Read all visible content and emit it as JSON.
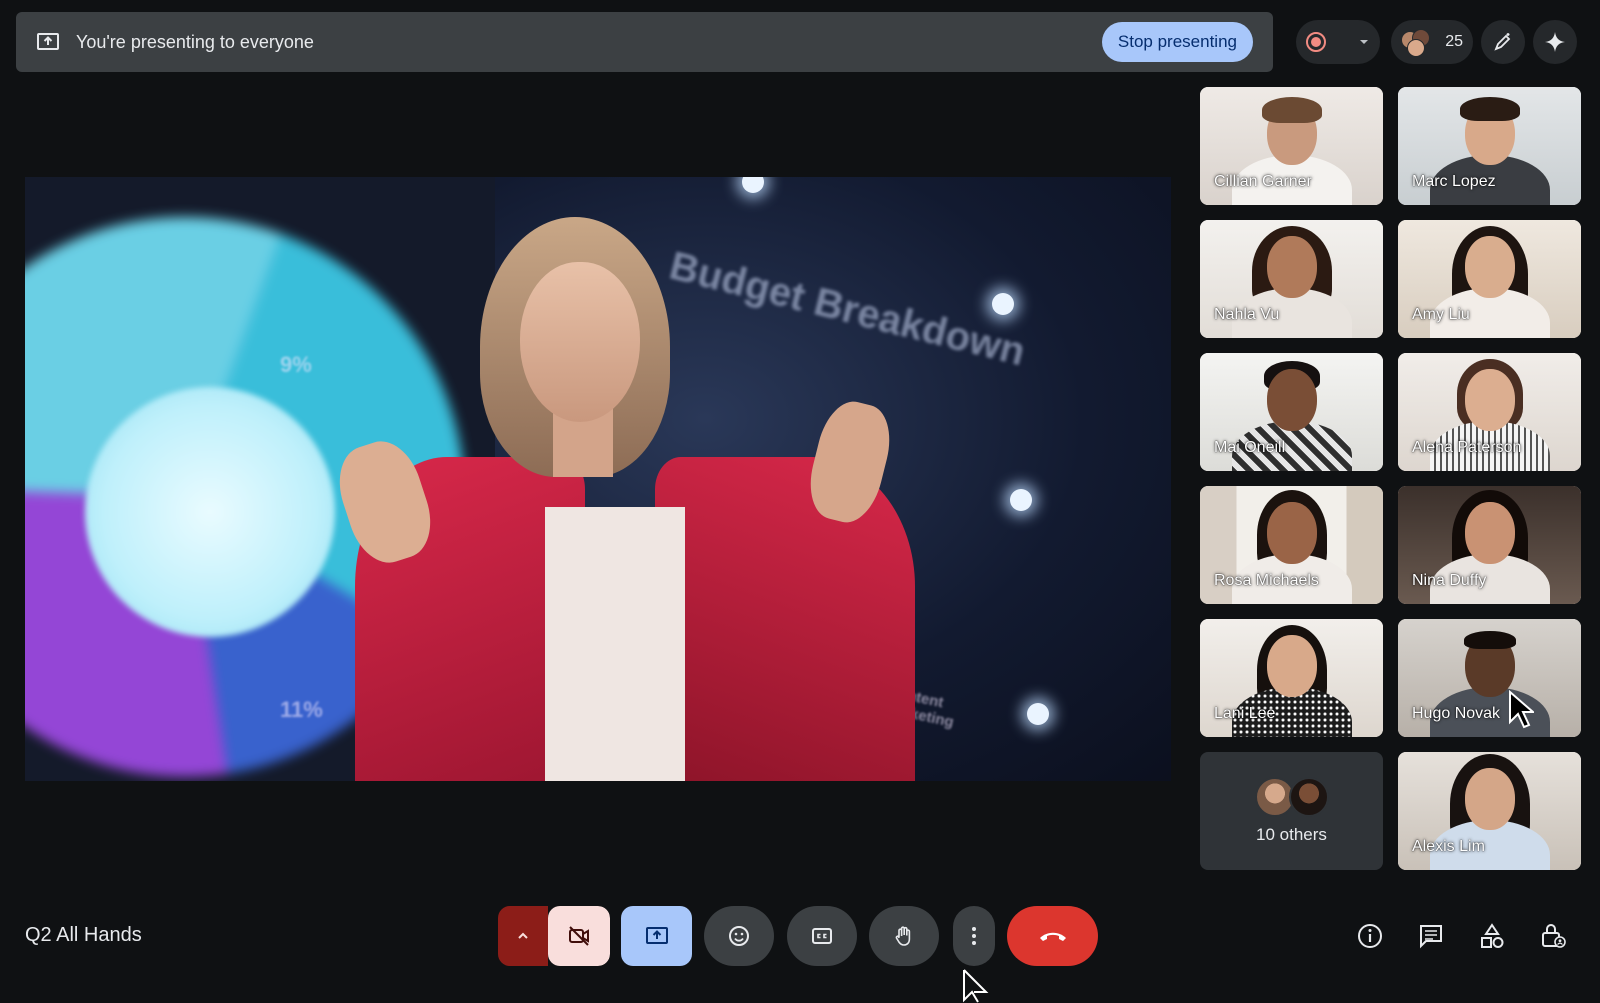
{
  "banner": {
    "text": "You're presenting to everyone",
    "stop_label": "Stop presenting"
  },
  "top_controls": {
    "participant_count": "25"
  },
  "stage": {
    "slide_title": "Budget Breakdown",
    "pie_labels": [
      "9%",
      "11%"
    ],
    "side_label": "Content Marketing"
  },
  "participants": [
    {
      "name": "Cillian Garner"
    },
    {
      "name": "Marc Lopez"
    },
    {
      "name": "Nahla Vu"
    },
    {
      "name": "Amy Liu"
    },
    {
      "name": "Mai Oneill"
    },
    {
      "name": "Alena Paterson"
    },
    {
      "name": "Rosa Michaels"
    },
    {
      "name": "Nina Duffy"
    },
    {
      "name": "Lani Lee"
    },
    {
      "name": "Hugo Novak"
    },
    {
      "name": "Alexis Lim"
    }
  ],
  "others_tile": {
    "label": "10 others"
  },
  "meeting": {
    "name": "Q2 All Hands"
  },
  "colors": {
    "accent_blue": "#a8c7fa",
    "leave_red": "#dc362e",
    "cam_off_bg": "#f9dedc",
    "bar_bg": "#3c4043"
  }
}
